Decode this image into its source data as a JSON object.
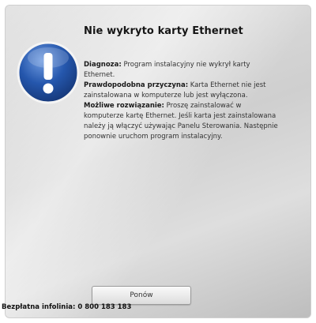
{
  "dialog": {
    "title": "Nie wykryto karty Ethernet",
    "diagnosis_label": "Diagnoza:",
    "diagnosis_text": "Program instalacyjny nie wykrył karty Ethernet.",
    "cause_label": "Prawdopodobna przyczyna:",
    "cause_text": "Karta Ethernet nie jest zainstalowana w komputerze lub jest wyłączona.",
    "solution_label": "Możliwe rozwiązanie:",
    "solution_text": "Proszę zainstalować w komputerze kartę Ethernet. Jeśli karta jest zainstalowana należy ją włączyć używając Panelu Sterowania. Następnie ponownie uruchom program instalacyjny.",
    "retry_button_label": "Ponów",
    "icon": "info-icon",
    "icon_color": "#1f4fa0"
  },
  "footer": {
    "helpline": "Bezpłatna infolinia: 0 800 183 183"
  }
}
